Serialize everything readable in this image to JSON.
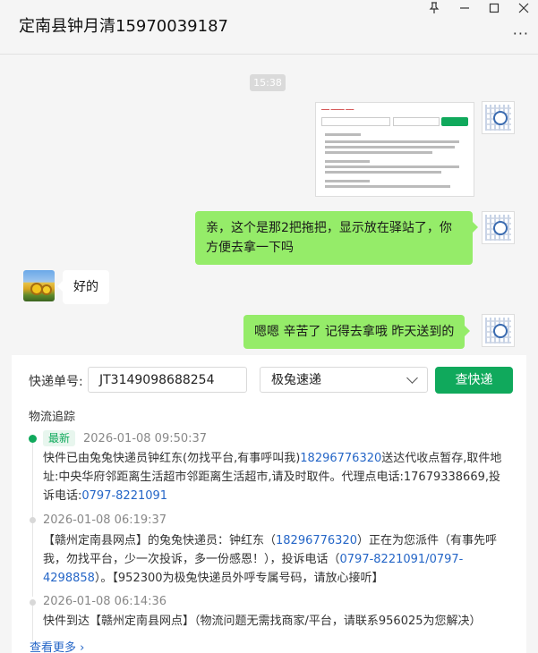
{
  "window": {
    "title": "定南县钟月清15970039187",
    "pin_icon": "pin-icon",
    "minimize_icon": "minimize-icon",
    "maximize_icon": "maximize-icon",
    "close_icon": "close-icon",
    "more_icon": "more-icon"
  },
  "chat": {
    "timestamp": "15:38",
    "messages": [
      {
        "from": "me",
        "type": "image"
      },
      {
        "from": "me",
        "text": "亲，这个是那2把拖把，显示放在驿站了，你方便去拿一下吗"
      },
      {
        "from": "other",
        "text": "好的"
      },
      {
        "from": "me",
        "text": "嗯嗯  辛苦了   记得去拿哦 昨天送到的"
      }
    ]
  },
  "tracking": {
    "number_label": "快递单号:",
    "number_value": "JT3149098688254",
    "carrier": "极兔速递",
    "query_button": "查快递",
    "section_title": "物流追踪",
    "latest_badge": "最新",
    "events": [
      {
        "time": "2026-01-08 09:50:37",
        "text_before": "快件已由兔兔快递员钟红东(勿找平台,有事呼叫我)",
        "phone": "18296776320",
        "text_mid": "送达代收点暂存,取件地址:中央华府邻距离生活超市邻距离生活超市,请及时取件。代理点电话:17679338669,投诉电话:",
        "phone2": "0797-8221091"
      },
      {
        "time": "2026-01-08 06:19:37",
        "text_before": "【赣州定南县网点】的兔兔快递员：钟红东（",
        "phone": "18296776320",
        "text_mid": "）正在为您派件（有事先呼我，勿找平台，少一次投诉，多一份感恩！），投诉电话（",
        "phone2": "0797-8221091/0797-4298858",
        "text_after": "）。【952300为极兔快递员外呼专属号码，请放心接听】"
      },
      {
        "time": "2026-01-08 06:14:36",
        "text_before": "快件到达【赣州定南县网点】（物流问题无需找商家/平台，请联系956025为您解决）"
      }
    ],
    "more_link": "查看更多 ›"
  }
}
